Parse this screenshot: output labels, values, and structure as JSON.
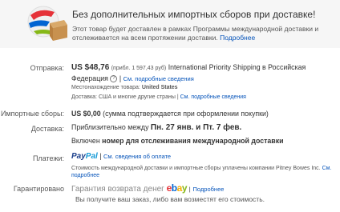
{
  "header": {
    "title": "Без дополнительных импортных сборов при доставке!",
    "description": "Этот товар будет доставлен в рамках Программы международной доставки и отслеживается на всем протяжении доставки.",
    "more_link": "Подробнее"
  },
  "shipping": {
    "label": "Отправка:",
    "price": "US $48,76",
    "approx": "(прибл. 1 597,43 руб)",
    "service": "International Priority Shipping в Российская Федерация",
    "details_link": "См. подробные сведения",
    "location_label": "Местонахождение товара:",
    "location_value": "United States",
    "ships_to_label": "Доставка:",
    "ships_to_value": "США и многие другие страны",
    "ships_to_link": "См. подробные сведения"
  },
  "import": {
    "label": "Импортные сборы:",
    "value": "US $0,00",
    "note": "(сумма подтверждается при оформлении покупки)"
  },
  "delivery": {
    "label": "Доставка:",
    "prefix": "Приблизительно между",
    "dates": "Пн. 27 янв. и Пт. 7 фев.",
    "tracking_prefix": "Включен",
    "tracking_bold": "номер для отслеживания международной доставки"
  },
  "payments": {
    "label": "Платежи:",
    "paypal_pay": "Pay",
    "paypal_pal": "Pal",
    "details_link": "См. сведения об оплате",
    "note": "Стоимость международной доставки и импортные сборы уплачены компании Pitney Bowes Inc.",
    "more_link": "См. подробнее"
  },
  "guarantee": {
    "label": "Гарантировано",
    "text": "Гарантия возврата денег",
    "ebay": [
      "e",
      "b",
      "a",
      "y"
    ],
    "more_link": "Подробнее"
  },
  "footer": {
    "text": "Вы получите ваш заказ, либо вам возместят его стоимость."
  },
  "colors": {
    "link": "#0654ba",
    "ebay_e": "#e53238",
    "ebay_b": "#0064d2",
    "ebay_a": "#f5af02",
    "ebay_y": "#86b817"
  }
}
